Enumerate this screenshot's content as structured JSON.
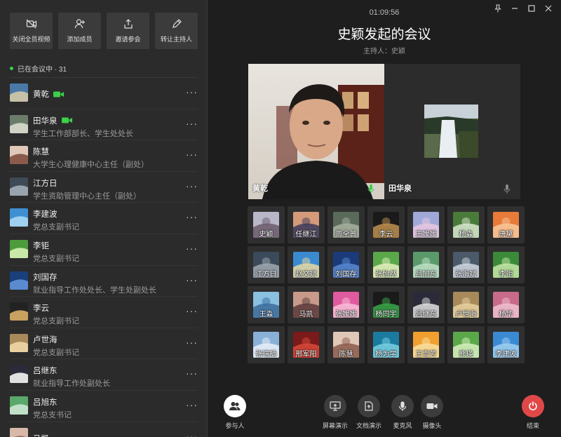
{
  "toolbar": {
    "buttons": [
      {
        "label": "关闭全员视频",
        "icon": "video-off-icon"
      },
      {
        "label": "添加成员",
        "icon": "add-user-icon"
      },
      {
        "label": "邀请参会",
        "icon": "share-icon"
      },
      {
        "label": "转让主持人",
        "icon": "pencil-icon"
      }
    ]
  },
  "status": {
    "in_meeting": "已在会议中 · 31"
  },
  "members": [
    {
      "name": "黄乾",
      "title": "",
      "camera": true,
      "avatar_colors": [
        "#4a79a8",
        "#c7c1a8"
      ]
    },
    {
      "name": "田华泉",
      "title": "学生工作部部长、学生处处长",
      "camera": true,
      "avatar_colors": [
        "#6c7c6a",
        "#cfd3c6"
      ]
    },
    {
      "name": "陈慧",
      "title": "大学生心理健康中心主任（副处）",
      "camera": false,
      "avatar_colors": [
        "#e0c8b8",
        "#8a5a4a"
      ]
    },
    {
      "name": "江方日",
      "title": "学生资助管理中心主任（副处）",
      "camera": false,
      "avatar_colors": [
        "#3e4a56",
        "#9aa4ac"
      ]
    },
    {
      "name": "李建波",
      "title": "党总支副书记",
      "camera": false,
      "avatar_colors": [
        "#3f8fd3",
        "#9fd0f0"
      ]
    },
    {
      "name": "李钜",
      "title": "党总支副书记",
      "camera": false,
      "avatar_colors": [
        "#4d9c3c",
        "#c8e8a8"
      ]
    },
    {
      "name": "刘国存",
      "title": "就业指导工作处处长、学生处副处长",
      "camera": false,
      "avatar_colors": [
        "#1a3f7a",
        "#5a8ad0"
      ]
    },
    {
      "name": "李云",
      "title": "党总支副书记",
      "camera": false,
      "avatar_colors": [
        "#222222",
        "#c8a060"
      ]
    },
    {
      "name": "卢世海",
      "title": "党总支副书记",
      "camera": false,
      "avatar_colors": [
        "#a88a5a",
        "#e8d0a0"
      ]
    },
    {
      "name": "吕继东",
      "title": "就业指导工作处副处长",
      "camera": false,
      "avatar_colors": [
        "#2a2a3a",
        "#e0e0e0"
      ]
    },
    {
      "name": "吕旭东",
      "title": "党总支书记",
      "camera": false,
      "avatar_colors": [
        "#5aa86a",
        "#c0e0c8"
      ]
    },
    {
      "name": "马凯",
      "title": "",
      "camera": false,
      "avatar_colors": [
        "#d8b8a8",
        "#9a6a5a"
      ]
    }
  ],
  "meeting": {
    "time": "01:09:56",
    "title": "史颖发起的会议",
    "host": "主持人：史颖"
  },
  "videos": [
    {
      "name": "黄乾"
    },
    {
      "name": "田华泉"
    }
  ],
  "participants": [
    {
      "name": "史颖",
      "c": [
        "#b9b6c8",
        "#6a5a6a"
      ]
    },
    {
      "name": "任继江",
      "c": [
        "#d49a7a",
        "#3a3a5a"
      ]
    },
    {
      "name": "周全普",
      "c": [
        "#5a6a5a",
        "#a8b0a0"
      ]
    },
    {
      "name": "李云",
      "c": [
        "#1a1a1a",
        "#c09050"
      ]
    },
    {
      "name": "王媛媛",
      "c": [
        "#a0a8d8",
        "#e8c8e0"
      ]
    },
    {
      "name": "杨淼",
      "c": [
        "#4a7a3a",
        "#d8e8d0"
      ]
    },
    {
      "name": "唐黛",
      "c": [
        "#e87a3a",
        "#f8c89a"
      ]
    },
    {
      "name": "江方日",
      "c": [
        "#3a4a5a",
        "#a0a8b0"
      ]
    },
    {
      "name": "赵文斌",
      "c": [
        "#3a8ad0",
        "#e8d8a0"
      ]
    },
    {
      "name": "刘国存",
      "c": [
        "#1a3a7a",
        "#5a8ad0"
      ]
    },
    {
      "name": "张怡然",
      "c": [
        "#5aa84a",
        "#e8f0c0"
      ]
    },
    {
      "name": "吕旭东",
      "c": [
        "#5a9a6a",
        "#c0e0c8"
      ]
    },
    {
      "name": "张海斌",
      "c": [
        "#4a5a6a",
        "#d0d8e0"
      ]
    },
    {
      "name": "李钜",
      "c": [
        "#3a8a3a",
        "#c8e8a8"
      ]
    },
    {
      "name": "王淼",
      "c": [
        "#8ac0e0",
        "#3a6a9a"
      ]
    },
    {
      "name": "马凯",
      "c": [
        "#c89a8a",
        "#5a3a3a"
      ]
    },
    {
      "name": "张媛媛",
      "c": [
        "#e05aa0",
        "#f8c0d8"
      ]
    },
    {
      "name": "杨同宇",
      "c": [
        "#1a1a1a",
        "#3aa84a"
      ]
    },
    {
      "name": "吕继东",
      "c": [
        "#2a2a3a",
        "#e0e0e0"
      ]
    },
    {
      "name": "卢世海",
      "c": [
        "#a88a5a",
        "#e8d0a0"
      ]
    },
    {
      "name": "杨华",
      "c": [
        "#c86a8a",
        "#f0c0d0"
      ]
    },
    {
      "name": "张瑞楠",
      "c": [
        "#8ab0d8",
        "#e8f0f8"
      ]
    },
    {
      "name": "邢军阳",
      "c": [
        "#7a1a1a",
        "#d84a3a"
      ]
    },
    {
      "name": "陈慧",
      "c": [
        "#e0c8b8",
        "#8a5a4a"
      ]
    },
    {
      "name": "杨为学",
      "c": [
        "#1a7aa0",
        "#7ad0e0"
      ]
    },
    {
      "name": "王雪芳",
      "c": [
        "#f0a030",
        "#f8e0a0"
      ]
    },
    {
      "name": "熊瑛",
      "c": [
        "#5aa84a",
        "#d8f0c0"
      ]
    },
    {
      "name": "李建波",
      "c": [
        "#3a8ad3",
        "#a0d0f0"
      ]
    }
  ],
  "controls": [
    {
      "label": "参与人",
      "icon": "participants-icon"
    },
    {
      "label": "屏幕演示",
      "icon": "screen-share-icon"
    },
    {
      "label": "文档演示",
      "icon": "document-share-icon"
    },
    {
      "label": "麦克风",
      "icon": "microphone-icon"
    },
    {
      "label": "摄像头",
      "icon": "camera-icon"
    },
    {
      "label": "结束",
      "icon": "power-icon"
    }
  ],
  "colors": {
    "accent_green": "#3bd04a",
    "end_red": "#e04848",
    "panel": "#2b2b2b",
    "bg": "#1e1e1e"
  }
}
